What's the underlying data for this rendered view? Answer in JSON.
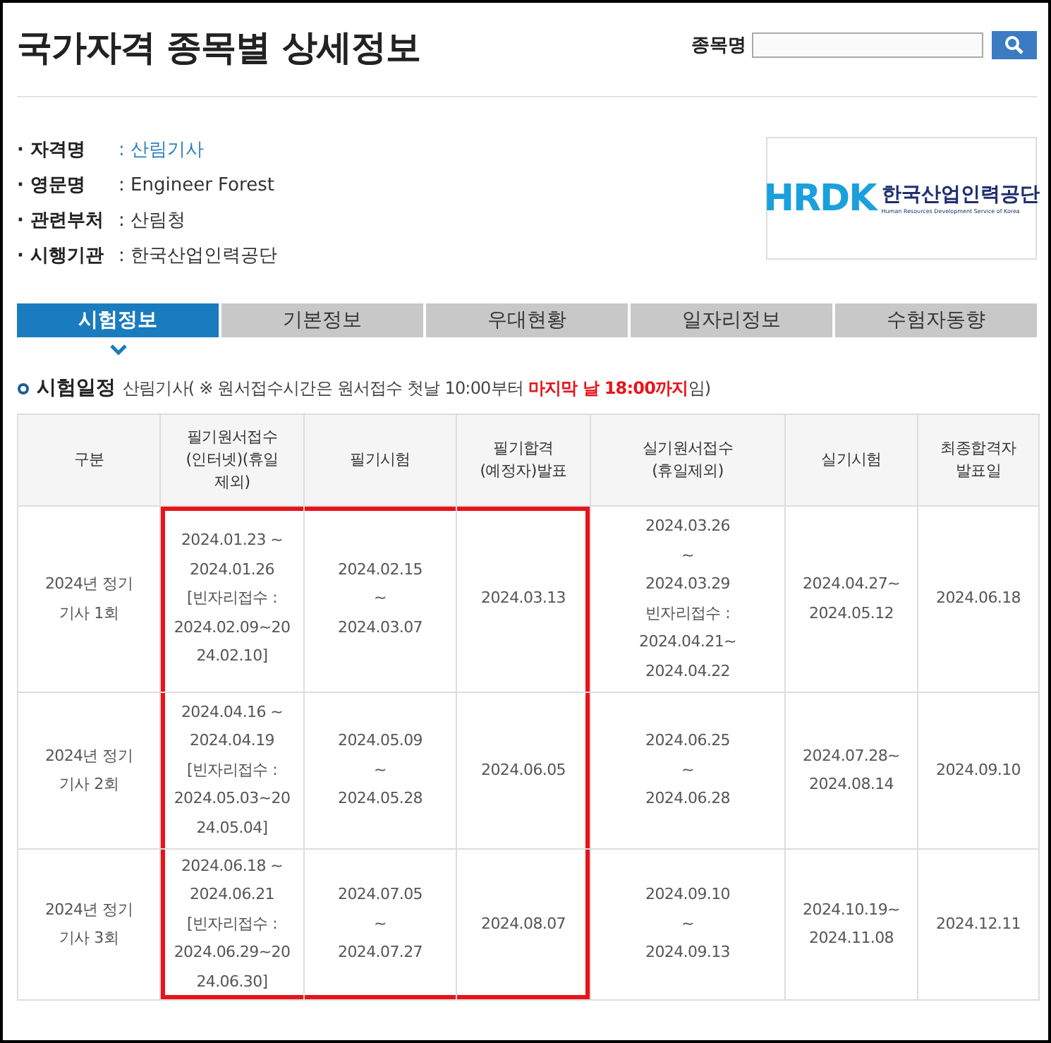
{
  "page_title": "국가자격 종목별 상세정보",
  "search": {
    "label": "종목명"
  },
  "info": [
    {
      "label": "· 자격명",
      "value": ": 산림기사",
      "link": true
    },
    {
      "label": "· 영문명",
      "value": ": Engineer Forest",
      "link": false
    },
    {
      "label": "· 관련부처",
      "value": ": 산림청",
      "link": false
    },
    {
      "label": "· 시행기관",
      "value": ": 한국산업인력공단",
      "link": false
    }
  ],
  "logo": {
    "mark": "HRDK",
    "name": "한국산업인력공단",
    "subtitle": "Human Resources Development Service of Korea"
  },
  "tabs": [
    {
      "label": "시험정보",
      "selected": true
    },
    {
      "label": "기본정보",
      "selected": false
    },
    {
      "label": "우대현황",
      "selected": false
    },
    {
      "label": "일자리정보",
      "selected": false
    },
    {
      "label": "수험자동향",
      "selected": false
    }
  ],
  "schedule": {
    "title": "시험일정",
    "note": "산림기사( ※ 원서접수시간은 원서접수 첫날 10:00부터 **마지막 날 18:00까지**임)"
  },
  "table": {
    "columns": [
      {
        "lines": [
          "구분"
        ],
        "highlighted": false
      },
      {
        "lines": [
          "필기원서접수",
          "(인터넷)(휴일",
          "제외)"
        ],
        "highlighted": true
      },
      {
        "lines": [
          "필기시험"
        ],
        "highlighted": true
      },
      {
        "lines": [
          "필기합격",
          "(예정자)발표"
        ],
        "highlighted": true
      },
      {
        "lines": [
          "실기원서접수",
          "(휴일제외)"
        ],
        "highlighted": false
      },
      {
        "lines": [
          "실기시험"
        ],
        "highlighted": false
      },
      {
        "lines": [
          "최종합격자",
          "발표일"
        ],
        "highlighted": false
      }
    ],
    "rows": [
      [
        [
          "2024년 정기",
          "기사 1회"
        ],
        [
          "2024.01.23 ~",
          "2024.01.26",
          "[빈자리접수 :",
          "2024.02.09~20",
          "24.02.10]"
        ],
        [
          "2024.02.15",
          "~",
          "2024.03.07"
        ],
        [
          "2024.03.13"
        ],
        [
          "2024.03.26",
          "~",
          "2024.03.29",
          "빈자리접수 :",
          "2024.04.21~",
          "2024.04.22"
        ],
        [
          "2024.04.27~",
          "2024.05.12"
        ],
        [
          "2024.06.18"
        ]
      ],
      [
        [
          "2024년 정기",
          "기사 2회"
        ],
        [
          "2024.04.16 ~",
          "2024.04.19",
          "[빈자리접수 :",
          "2024.05.03~20",
          "24.05.04]"
        ],
        [
          "2024.05.09",
          "~",
          "2024.05.28"
        ],
        [
          "2024.06.05"
        ],
        [
          "2024.06.25",
          "~",
          "2024.06.28"
        ],
        [
          "2024.07.28~",
          "2024.08.14"
        ],
        [
          "2024.09.10"
        ]
      ],
      [
        [
          "2024년 정기",
          "기사 3회"
        ],
        [
          "2024.06.18 ~",
          "2024.06.21",
          "[빈자리접수 :",
          "2024.06.29~20",
          "24.06.30]"
        ],
        [
          "2024.07.05",
          "~",
          "2024.07.27"
        ],
        [
          "2024.08.07"
        ],
        [
          "2024.09.10",
          "~",
          "2024.09.13"
        ],
        [
          "2024.10.19~",
          "2024.11.08"
        ],
        [
          "2024.12.11"
        ]
      ]
    ]
  }
}
